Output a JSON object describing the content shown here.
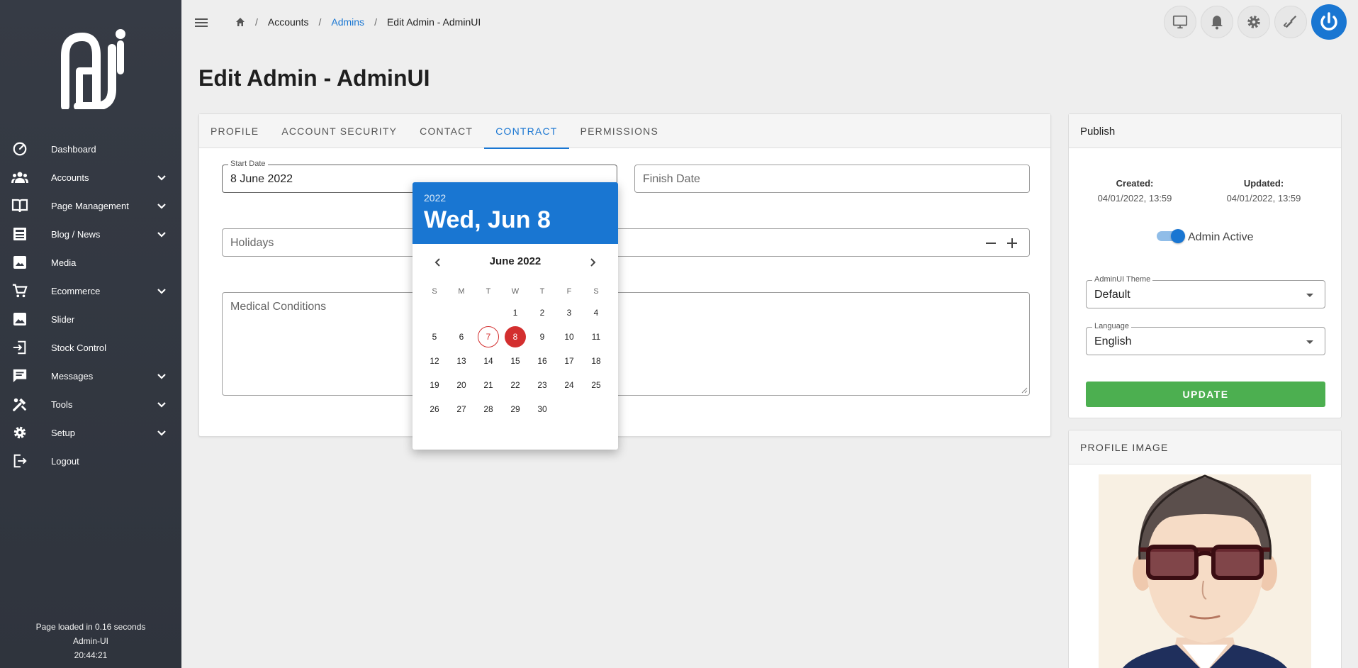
{
  "sidebar": {
    "items": [
      {
        "label": "Dashboard",
        "icon": "dashboard-gauge-icon",
        "has_submenu": false
      },
      {
        "label": "Accounts",
        "icon": "users-icon",
        "has_submenu": true
      },
      {
        "label": "Page Management",
        "icon": "book-icon",
        "has_submenu": true
      },
      {
        "label": "Blog / News",
        "icon": "news-icon",
        "has_submenu": true
      },
      {
        "label": "Media",
        "icon": "photo-library-icon",
        "has_submenu": false
      },
      {
        "label": "Ecommerce",
        "icon": "cart-icon",
        "has_submenu": true
      },
      {
        "label": "Slider",
        "icon": "image-icon",
        "has_submenu": false
      },
      {
        "label": "Stock Control",
        "icon": "login-box-icon",
        "has_submenu": false
      },
      {
        "label": "Messages",
        "icon": "chat-icon",
        "has_submenu": true
      },
      {
        "label": "Tools",
        "icon": "tools-icon",
        "has_submenu": true
      },
      {
        "label": "Setup",
        "icon": "gear-icon",
        "has_submenu": true
      },
      {
        "label": "Logout",
        "icon": "logout-icon",
        "has_submenu": false
      }
    ],
    "footer": {
      "load_time": "Page loaded in 0.16 seconds",
      "app_name": "Admin-UI",
      "clock": "20:44:21"
    }
  },
  "breadcrumb": {
    "home_icon": "home-icon",
    "items": [
      "Accounts",
      "Admins",
      "Edit Admin - AdminUI"
    ]
  },
  "page_title": "Edit Admin - AdminUI",
  "tabs": [
    "PROFILE",
    "ACCOUNT SECURITY",
    "CONTACT",
    "CONTRACT",
    "PERMISSIONS"
  ],
  "active_tab": "CONTRACT",
  "form": {
    "start_date_label": "Start Date",
    "start_date_value": "8 June 2022",
    "finish_date_placeholder": "Finish Date",
    "holidays_placeholder": "Holidays",
    "medical_placeholder": "Medical Conditions"
  },
  "datepicker": {
    "year": "2022",
    "selected_long": "Wed, Jun 8",
    "month_label": "June 2022",
    "weekdays": [
      "S",
      "M",
      "T",
      "W",
      "T",
      "F",
      "S"
    ],
    "leading_blanks": 3,
    "days_in_month": 30,
    "today": 7,
    "selected": 8
  },
  "publish": {
    "title": "Publish",
    "created_label": "Created:",
    "created_value": "04/01/2022, 13:59",
    "updated_label": "Updated:",
    "updated_value": "04/01/2022, 13:59",
    "active_label": "Admin Active",
    "active": true,
    "theme_label": "AdminUI Theme",
    "theme_value": "Default",
    "language_label": "Language",
    "language_value": "English",
    "update_label": "UPDATE"
  },
  "profile_image": {
    "title": "PROFILE IMAGE"
  },
  "colors": {
    "sidebar_bg": "#363b45",
    "accent": "#1976d2",
    "selected_day": "#d32f2f",
    "update_button": "#4caf50"
  }
}
